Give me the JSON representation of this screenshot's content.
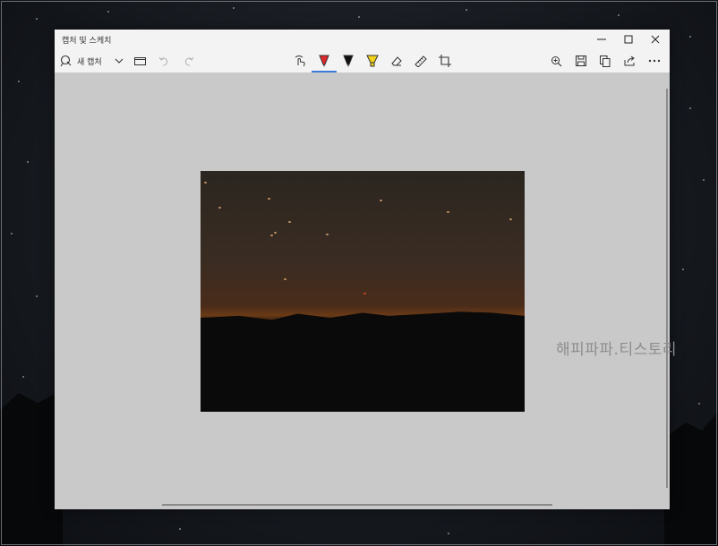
{
  "window": {
    "title": "캡처 및 스케치",
    "controls": {
      "minimize": "minimize-icon",
      "maximize": "maximize-icon",
      "close": "close-icon"
    }
  },
  "toolbar": {
    "new_capture_label": "새 캡처",
    "left_icons": [
      "new-capture-icon",
      "chevron-down-icon",
      "folder-icon",
      "undo-icon",
      "redo-icon"
    ],
    "center_tools": [
      "touch-writing-icon",
      "ballpoint-pen-icon",
      "pencil-icon",
      "highlighter-icon",
      "eraser-icon",
      "ruler-icon",
      "crop-icon"
    ],
    "active_tool": "ballpoint-pen-icon",
    "right_icons": [
      "zoom-icon",
      "save-icon",
      "copy-icon",
      "share-icon",
      "more-icon"
    ]
  },
  "colors": {
    "accent": "#3a7bd5",
    "pen": "#e0262e",
    "highlighter": "#f2d21b"
  },
  "watermark": "해피파파.티스토리"
}
